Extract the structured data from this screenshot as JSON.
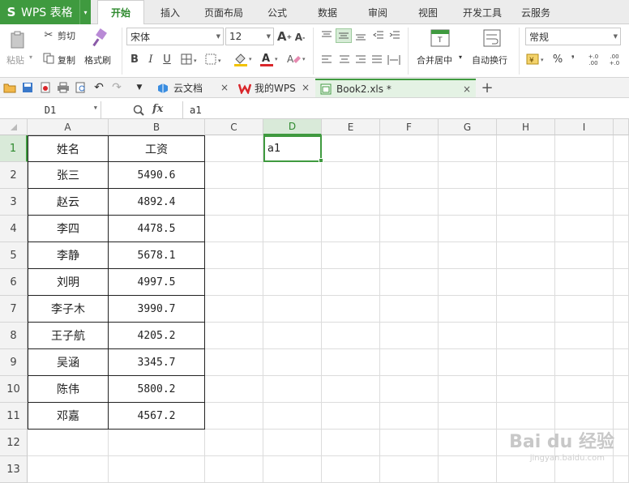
{
  "app": {
    "logo": "S",
    "title": "WPS 表格",
    "arrow": "▾"
  },
  "menu_tabs": [
    "开始",
    "插入",
    "页面布局",
    "公式",
    "数据",
    "审阅",
    "视图",
    "开发工具",
    "云服务"
  ],
  "ribbon": {
    "paste": "粘贴",
    "cut": "剪切",
    "copy": "复制",
    "format_painter": "格式刷",
    "font_name": "宋体",
    "font_size": "12",
    "merge_center": "合并居中",
    "wrap_text": "自动换行",
    "number_format": "常规",
    "percent": "%",
    "comma": "❜",
    "inc_decimal": "+.0 .00",
    "dec_decimal": ".00 +.0"
  },
  "doc_tabs": [
    {
      "label": "云文档"
    },
    {
      "label": "我的WPS"
    },
    {
      "label": "Book2.xls *"
    }
  ],
  "formula_bar": {
    "cell_ref": "D1",
    "fx": "fx",
    "content": "a1"
  },
  "columns": [
    "A",
    "B",
    "C",
    "D",
    "E",
    "F",
    "G",
    "H",
    "I"
  ],
  "rows": [
    "1",
    "2",
    "3",
    "4",
    "5",
    "6",
    "7",
    "8",
    "9",
    "10",
    "11",
    "12",
    "13"
  ],
  "table": {
    "header": {
      "name": "姓名",
      "salary": "工资"
    },
    "records": [
      {
        "name": "张三",
        "salary": "5490.6"
      },
      {
        "name": "赵云",
        "salary": "4892.4"
      },
      {
        "name": "李四",
        "salary": "4478.5"
      },
      {
        "name": "李静",
        "salary": "5678.1"
      },
      {
        "name": "刘明",
        "salary": "4997.5"
      },
      {
        "name": "李子木",
        "salary": "3990.7"
      },
      {
        "name": "王子航",
        "salary": "4205.2"
      },
      {
        "name": "吴涵",
        "salary": "3345.7"
      },
      {
        "name": "陈伟",
        "salary": "5800.2"
      },
      {
        "name": "邓嘉",
        "salary": "4567.2"
      }
    ]
  },
  "active_cell": {
    "ref": "D1",
    "value": "a1"
  },
  "watermark": {
    "main": "Bai du 经验",
    "sub": "jingyan.baidu.com"
  },
  "colors": {
    "accent": "#3f9a3f",
    "font_color": "#d9262b",
    "fill_color": "#f2c200"
  }
}
